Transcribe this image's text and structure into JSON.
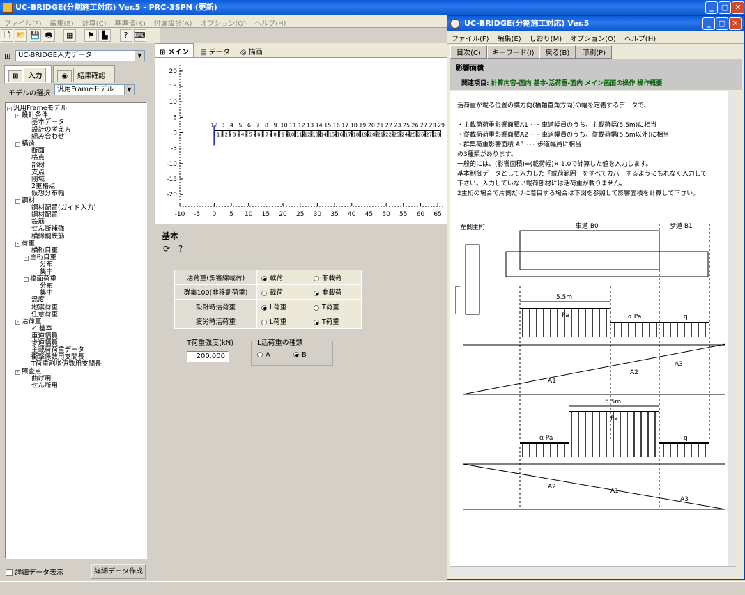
{
  "main_window": {
    "title": "UC-BRIDGE(分割施工対応) Ver.5 - PRC-3SPN (更新)"
  },
  "menu": [
    "ファイル(F)",
    "編集(E)",
    "計算(C)",
    "基準値(K)",
    "付属設計(A)",
    "オプション(O)",
    "ヘルプ(H)"
  ],
  "left_panel": {
    "data_combo": "UC-BRIDGE入力データ",
    "tabs": [
      "入力",
      "結果確認"
    ],
    "model_label": "モデルの選択",
    "model_value": "汎用Frameモデル",
    "tree": [
      {
        "label": "汎用Frameモデル",
        "level": 0,
        "box": "-"
      },
      {
        "label": "設計条件",
        "level": 1,
        "box": "-"
      },
      {
        "label": "基本データ",
        "level": 2
      },
      {
        "label": "設計の考え方",
        "level": 2
      },
      {
        "label": "組み合わせ",
        "level": 2
      },
      {
        "label": "構造",
        "level": 1,
        "box": "-"
      },
      {
        "label": "断面",
        "level": 2
      },
      {
        "label": "格点",
        "level": 2
      },
      {
        "label": "部材",
        "level": 2
      },
      {
        "label": "支点",
        "level": 2
      },
      {
        "label": "剛域",
        "level": 2
      },
      {
        "label": "2重格点",
        "level": 2
      },
      {
        "label": "仮想分布幅",
        "level": 2
      },
      {
        "label": "鋼材",
        "level": 1,
        "box": "-"
      },
      {
        "label": "鋼材配置(ガイド入力)",
        "level": 2
      },
      {
        "label": "鋼材配置",
        "level": 2
      },
      {
        "label": "鉄筋",
        "level": 2
      },
      {
        "label": "せん断補強",
        "level": 2
      },
      {
        "label": "横締鋼鉄筋",
        "level": 2
      },
      {
        "label": "荷重",
        "level": 1,
        "box": "-"
      },
      {
        "label": "横桁自重",
        "level": 2
      },
      {
        "label": "主桁自重",
        "level": 2,
        "box": "-"
      },
      {
        "label": "分布",
        "level": 3
      },
      {
        "label": "集中",
        "level": 3
      },
      {
        "label": "橋面荷重",
        "level": 2,
        "box": "-"
      },
      {
        "label": "分布",
        "level": 3
      },
      {
        "label": "集中",
        "level": 3
      },
      {
        "label": "温度",
        "level": 2
      },
      {
        "label": "地震荷重",
        "level": 2
      },
      {
        "label": "任意荷重",
        "level": 2
      },
      {
        "label": "活荷重",
        "level": 1,
        "box": "-"
      },
      {
        "label": "✓ 基本",
        "level": 2
      },
      {
        "label": "車道幅員",
        "level": 2
      },
      {
        "label": "歩道幅員",
        "level": 2
      },
      {
        "label": "主載荷荷重データ",
        "level": 2
      },
      {
        "label": "衝撃係数用支間長",
        "level": 2
      },
      {
        "label": "T荷重割増係数用支間長",
        "level": 2
      },
      {
        "label": "照査点",
        "level": 1,
        "box": "-"
      },
      {
        "label": "曲げ用",
        "level": 2
      },
      {
        "label": "せん断用",
        "level": 2
      }
    ],
    "detail_checkbox": "詳細データ表示",
    "detail_button": "詳細データ作成"
  },
  "view_tabs": [
    "メイン",
    "データ",
    "描画"
  ],
  "chart_data": {
    "type": "line",
    "x_ticks": [
      "-10",
      "-5",
      "0",
      "5",
      "10",
      "15",
      "20",
      "25",
      "30",
      "35",
      "40",
      "45",
      "50",
      "55",
      "60",
      "65"
    ],
    "y_ticks": [
      "20",
      "15",
      "10",
      "5",
      "0",
      "-5",
      "-10",
      "-15",
      "-20"
    ],
    "xlim": [
      -10,
      67
    ],
    "ylim": [
      -22,
      22
    ],
    "node_labels": [
      "12",
      "3",
      "4",
      "5",
      "6",
      "7",
      "8",
      "9",
      "10",
      "11",
      "12",
      "13",
      "14",
      "15",
      "16",
      "17",
      "18",
      "19",
      "20",
      "21",
      "22",
      "23",
      "25",
      "26",
      "27",
      "28",
      "29"
    ],
    "member_labels": [
      "1",
      "2",
      "3",
      "4",
      "5",
      "6",
      "7",
      "8",
      "9",
      "10",
      "11",
      "12",
      "13",
      "14",
      "15",
      "16",
      "17",
      "18",
      "19",
      "20",
      "21",
      "22",
      "23",
      "24",
      "25",
      "26",
      "27",
      "28"
    ]
  },
  "basic_panel": {
    "title": "基本",
    "rows": [
      {
        "label": "活荷重(影響線載荷)",
        "opt1": "載荷",
        "opt2": "非載荷",
        "sel": 1
      },
      {
        "label": "群集100(非移動荷重)",
        "opt1": "載荷",
        "opt2": "非載荷",
        "sel": 2
      },
      {
        "label": "設計時活荷重",
        "opt1": "L荷重",
        "opt2": "T荷重",
        "sel": 1
      },
      {
        "label": "疲労時活荷重",
        "opt1": "L荷重",
        "opt2": "T荷重",
        "sel": 2
      }
    ],
    "t_label": "T荷重強度(kN)",
    "t_value": "200.000",
    "l_group": "L活荷重の種類",
    "l_opt_a": "A",
    "l_opt_b": "B"
  },
  "help_window": {
    "title": "UC-BRIDGE(分割施工対応) Ver.5",
    "menu": [
      "ファイル(F)",
      "編集(E)",
      "しおり(M)",
      "オプション(O)",
      "ヘルプ(H)"
    ],
    "buttons": [
      "目次(C)",
      "キーワード(I)",
      "戻る(B)",
      "印刷(P)"
    ],
    "heading": "影響面積",
    "related_label": "関連項目:",
    "links": [
      "計算内容-面内",
      "基本-活荷重-面内",
      "メイン画面の操作",
      "操作概要"
    ],
    "body": [
      "活荷重が載る位置の横方向(橋軸直角方向)の幅を定義するデータで、",
      "",
      "・主載荷荷重影響面積A1 ･･･ 車道幅員のうち、主載荷幅(5.5m)に相当",
      "・従載荷荷重影響面積A2 ･･･ 車道幅員のうち、従載荷幅(5.5m以外)に相当",
      "・群集荷重影響面積 A3 ･･･ 歩道幅員に相当",
      "の3種類があります。",
      "一般的には、(影響面積)=(載荷幅)× 1.0で計算した値を入力します。",
      "基本制御データとして入力した「載荷範囲」をすべてカバーするようにもれなく入力して",
      "下さい。入力していない載荷部材には活荷重が載りません。",
      "2主桁の場合で片側だけに着目する場合は下図を参照して影響面積を計算して下さい。"
    ],
    "diagram": {
      "left_label": "左側主桁",
      "b0": "車道 B0",
      "b1": "歩道 B1",
      "w1": "5.5m",
      "w2": "5.5m",
      "pa": "Pa",
      "apa": "α Pa",
      "q": "q",
      "a1": "A1",
      "a2": "A2",
      "a3": "A3"
    }
  }
}
